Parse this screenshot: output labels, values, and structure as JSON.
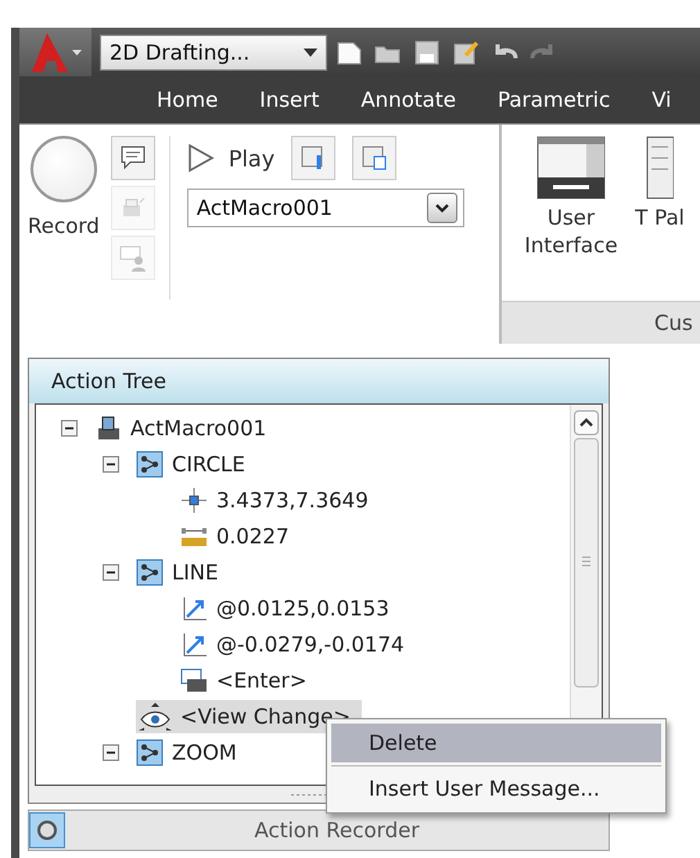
{
  "title_bar": {
    "workspace": "2D Drafting..."
  },
  "ribbon_tabs": [
    "Home",
    "Insert",
    "Annotate",
    "Parametric",
    "Vi"
  ],
  "ribbon": {
    "record_label": "Record",
    "side_tools": [
      {
        "kind": "message",
        "disabled": false
      },
      {
        "kind": "request",
        "disabled": true
      },
      {
        "kind": "user",
        "disabled": true
      }
    ],
    "play_label": "Play",
    "macro_value": "ActMacro001",
    "tools": [
      {
        "kind": "cui",
        "label": "User Interface"
      },
      {
        "kind": "palette",
        "label": "T Pal"
      }
    ],
    "panel_label": "Cus"
  },
  "action_tree": {
    "title": "Action Tree",
    "items": [
      {
        "kind": "macro",
        "label": "ActMacro001",
        "expanded": true,
        "selected": false,
        "children": [
          {
            "kind": "command",
            "label": "CIRCLE",
            "expanded": true,
            "selected": false,
            "children": [
              {
                "kind": "point",
                "label": "3.4373,7.3649",
                "selected": false
              },
              {
                "kind": "distance",
                "label": "0.0227",
                "selected": false
              }
            ]
          },
          {
            "kind": "command",
            "label": "LINE",
            "expanded": true,
            "selected": false,
            "children": [
              {
                "kind": "vector",
                "label": "@0.0125,0.0153",
                "selected": false
              },
              {
                "kind": "vector",
                "label": "@-0.0279,-0.0174",
                "selected": false
              },
              {
                "kind": "enter",
                "label": "<Enter>",
                "selected": false
              }
            ]
          },
          {
            "kind": "view",
            "label": "<View Change>",
            "selected": true
          },
          {
            "kind": "command",
            "label": "ZOOM",
            "expanded": true,
            "selected": false
          }
        ]
      }
    ]
  },
  "palette_bar": {
    "title": "Action Recorder"
  },
  "context_menu": [
    {
      "label": "Delete",
      "selected": true
    },
    {
      "label": "Insert User Message...",
      "selected": false
    }
  ]
}
